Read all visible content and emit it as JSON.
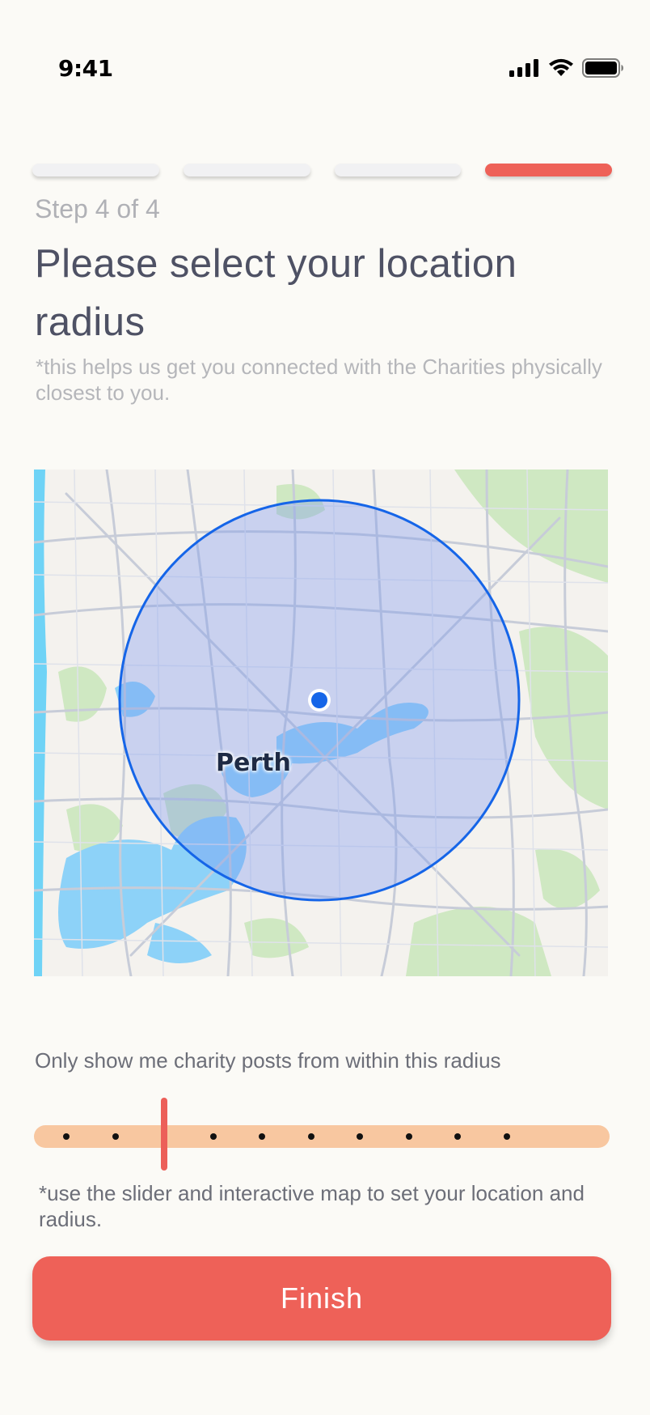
{
  "status_bar": {
    "time": "9:41",
    "icons": [
      "cellular-signal-icon",
      "wifi-icon",
      "battery-icon"
    ]
  },
  "progress": {
    "total_steps": 4,
    "current_step": 4,
    "active_color": "#ee6158",
    "step_label": "Step 4 of 4"
  },
  "header": {
    "title": "Please select your location radius",
    "subtitle": "*this helps us get you connected with the Charities physically closest to you."
  },
  "map": {
    "city_label": "Perth",
    "radius_circle_color": "#1565e8",
    "location_pin_color": "#1565e8"
  },
  "radius": {
    "label": "Only show me charity posts from within this radius",
    "slider_stops": 10,
    "selected_stop_index": 2,
    "track_color": "#f8c7a0",
    "thumb_color": "#ec5f59",
    "hint": "*use the slider and interactive map to set your location and radius."
  },
  "actions": {
    "finish_label": "Finish",
    "button_color": "#ee6158"
  }
}
